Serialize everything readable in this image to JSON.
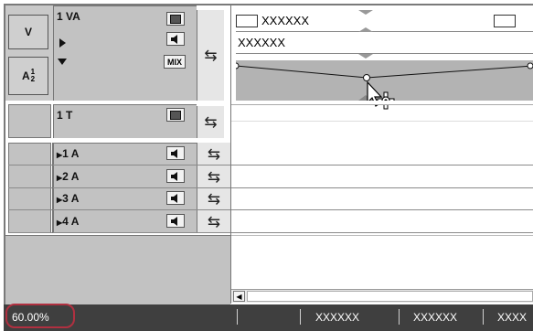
{
  "video_track": {
    "label": "1 VA",
    "v_button": "V",
    "a_button": "A",
    "a_sup": "1",
    "a_sub": "2",
    "mix_label": "MIX"
  },
  "title_track": {
    "label": "1 T"
  },
  "audio_tracks": [
    {
      "label": "1 A"
    },
    {
      "label": "2 A"
    },
    {
      "label": "3 A"
    },
    {
      "label": "4 A"
    }
  ],
  "clips": {
    "clip1_name": "XXXXXX",
    "clip2_name": "XXXXXX"
  },
  "status_bar": {
    "zoom": "60.00%",
    "timecodes": [
      "XXXXXX",
      "XXXXXX",
      "XXXX"
    ]
  }
}
